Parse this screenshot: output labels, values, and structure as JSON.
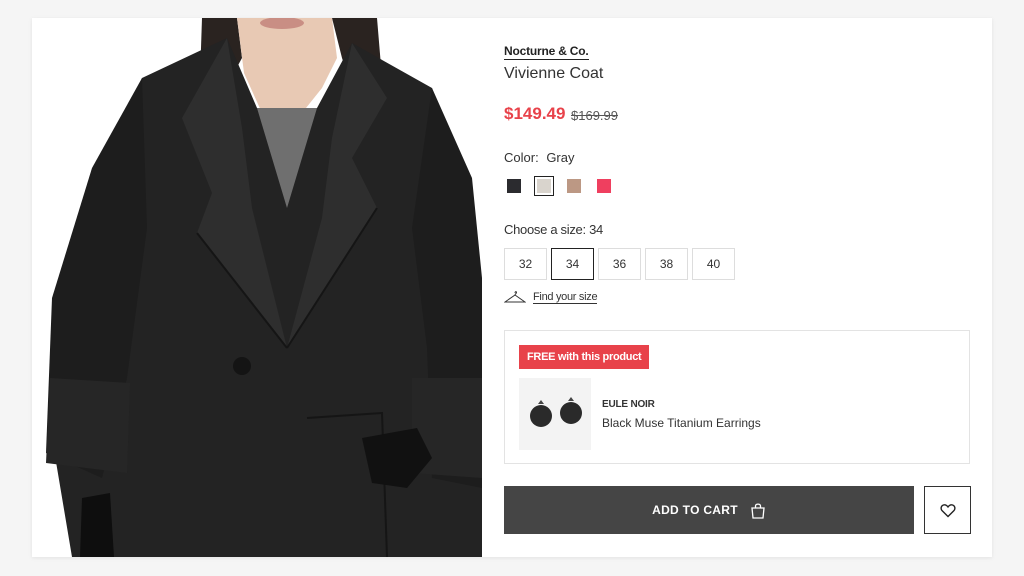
{
  "product": {
    "brand": "Nocturne & Co.",
    "name": "Vivienne Coat",
    "price_sale": "$149.49",
    "price_original": "$169.99",
    "image": "coat-photo"
  },
  "colors": {
    "label": "Color:",
    "selected": "Gray",
    "swatches": [
      {
        "name": "black",
        "hex": "#2b2b2f"
      },
      {
        "name": "gray",
        "hex": "#d9d4cd"
      },
      {
        "name": "tan",
        "hex": "#bc9884"
      },
      {
        "name": "pink",
        "hex": "#ef3f5f"
      }
    ]
  },
  "sizes": {
    "label": "Choose a size: 34",
    "options": [
      "32",
      "34",
      "36",
      "38",
      "40"
    ],
    "selected": "34",
    "find_size": "Find your size"
  },
  "promo": {
    "badge": "FREE with this product",
    "item_brand": "EULE NOIR",
    "item_name": "Black Muse Titanium Earrings"
  },
  "actions": {
    "add_to_cart": "ADD TO CART"
  },
  "theme": {
    "accent": "#e8424a",
    "button_bg": "#454545"
  }
}
